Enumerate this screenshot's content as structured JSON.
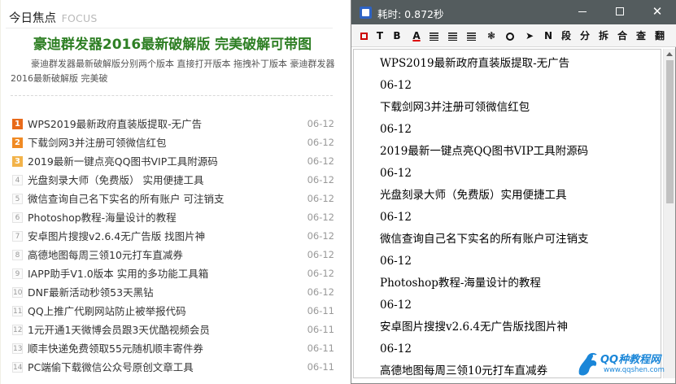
{
  "left_panel": {
    "header_title": "今日焦点",
    "header_focus": "FOCUS",
    "headline": "豪迪群发器2016最新破解版 完美破解可带图",
    "summary": "豪迪群发器最新破解版分别两个版本 直接打开版本 拖拽补丁版本 豪迪群发器2016最新破解版 完美破",
    "news": [
      {
        "rank": "1",
        "title": "WPS2019最新政府直装版提取-无广告",
        "date": "06-12"
      },
      {
        "rank": "2",
        "title": "下载剑网3并注册可领微信红包",
        "date": "06-12"
      },
      {
        "rank": "3",
        "title": "2019最新一键点亮QQ图书VIP工具附源码",
        "date": "06-12"
      },
      {
        "rank": "4",
        "title": "光盘刻录大师（免费版） 实用便捷工具",
        "date": "06-12"
      },
      {
        "rank": "5",
        "title": "微信查询自己名下实名的所有账户 可注销支",
        "date": "06-12"
      },
      {
        "rank": "6",
        "title": "Photoshop教程-海量设计的教程",
        "date": "06-12"
      },
      {
        "rank": "7",
        "title": "安卓图片搜搜v2.6.4无广告版 找图片神",
        "date": "06-12"
      },
      {
        "rank": "8",
        "title": "高德地图每周三领10元打车直减券",
        "date": "06-12"
      },
      {
        "rank": "9",
        "title": "IAPP助手V1.0版本 实用的多功能工具箱",
        "date": "06-12"
      },
      {
        "rank": "10",
        "title": "DNF最新活动秒领53天黑钻",
        "date": "06-12"
      },
      {
        "rank": "11",
        "title": "QQ上推广代刷网站防止被举报代码",
        "date": "06-11"
      },
      {
        "rank": "12",
        "title": "1元开通1天微博会员跟3天优酷视频会员",
        "date": "06-11"
      },
      {
        "rank": "13",
        "title": "顺丰快递免费领取55元随机顺丰寄件券",
        "date": "06-11"
      },
      {
        "rank": "14",
        "title": "PC端偷下载微信公众号原创文章工具",
        "date": "06-11"
      }
    ]
  },
  "window": {
    "title": "耗时: 0.872秒",
    "controls": {
      "minimize": "",
      "maximize": "",
      "close": "✕"
    },
    "toolbar": [
      {
        "name": "red-square-icon",
        "label": ""
      },
      {
        "name": "text-t-button",
        "label": "T"
      },
      {
        "name": "bold-button",
        "label": "B"
      },
      {
        "name": "font-color-button",
        "label": "A"
      },
      {
        "name": "align-left-icon",
        "label": ""
      },
      {
        "name": "align-center-icon",
        "label": ""
      },
      {
        "name": "justify-icon",
        "label": ""
      },
      {
        "name": "palette-icon",
        "label": "❃"
      },
      {
        "name": "search-icon",
        "label": ""
      },
      {
        "name": "send-icon",
        "label": "➤"
      },
      {
        "name": "n-button",
        "label": "N"
      },
      {
        "name": "paragraph-button",
        "label": "段"
      },
      {
        "name": "split-button",
        "label": "分"
      },
      {
        "name": "disassemble-button",
        "label": "拆"
      },
      {
        "name": "merge-button",
        "label": "合"
      },
      {
        "name": "lookup-button",
        "label": "查"
      },
      {
        "name": "translate-button",
        "label": "翻"
      }
    ],
    "content_lines": [
      "WPS2019最新政府直装版提取-无广告",
      "06-12",
      "下载剑网3并注册可领微信红包",
      "06-12",
      "2019最新一键点亮QQ图书VIP工具附源码",
      "06-12",
      "光盘刻录大师（免费版）实用便捷工具",
      "06-12",
      "微信查询自己名下实名的所有账户可注销支",
      "06-12",
      "Photoshop教程-海量设计的教程",
      "06-12",
      "安卓图片搜搜v2.6.4无广告版找图片神",
      "06-12",
      "高德地图每周三领10元打车直减券"
    ]
  },
  "watermark": {
    "title": "QQ种教程网",
    "url": "www.qqshen.com"
  },
  "colors": {
    "headline": "#2e7f24",
    "titlebar": "#545c5e",
    "rank1": "#e86a1a",
    "rank2": "#f08a24",
    "rank3": "#f2b34a",
    "watermark": "#1a86d8"
  }
}
